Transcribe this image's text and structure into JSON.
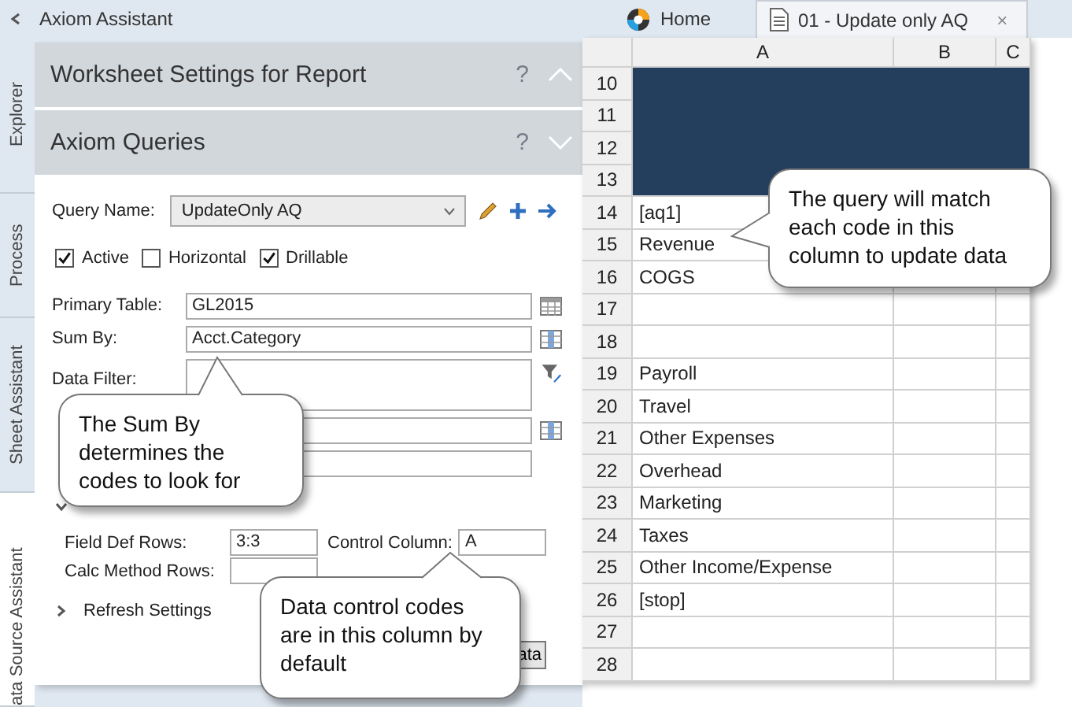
{
  "sidebar_title": "Axiom Assistant",
  "side_tabs": [
    {
      "label": "Explorer",
      "selected": false
    },
    {
      "label": "Process",
      "selected": false
    },
    {
      "label": "Sheet Assistant",
      "selected": false
    },
    {
      "label": "ata Source Assistant",
      "selected": true
    }
  ],
  "sections": [
    {
      "title": "Worksheet Settings for Report",
      "help": "?",
      "expanded": false
    },
    {
      "title": "Axiom Queries",
      "help": "?",
      "expanded": true
    }
  ],
  "query": {
    "label": "Query Name:",
    "value": "UpdateOnly AQ"
  },
  "checkboxes": [
    {
      "label": "Active",
      "checked": true
    },
    {
      "label": "Horizontal",
      "checked": false
    },
    {
      "label": "Drillable",
      "checked": true
    }
  ],
  "fields": [
    {
      "label": "Primary Table:",
      "value": "GL2015",
      "kind": "line"
    },
    {
      "label": "Sum By:",
      "value": "Acct.Category",
      "kind": "line"
    },
    {
      "label": "Data Filter:",
      "kind": "multiline"
    },
    {
      "kind": "line"
    },
    {
      "kind": "line"
    }
  ],
  "control_group": {
    "expanded": true
  },
  "field_def_rows": {
    "label": "Field Def Rows:",
    "value": "3:3"
  },
  "control_column": {
    "label": "Control Column:",
    "value": "A"
  },
  "calc_method_rows": {
    "label": "Calc Method Rows:"
  },
  "refresh_settings": {
    "label": "Refresh Settings",
    "expanded": false
  },
  "button": "ata",
  "tabs": [
    {
      "label": "Home",
      "kind": "home",
      "selected": false
    },
    {
      "label": "01 - Update only AQ",
      "kind": "document",
      "selected": true,
      "close": "×"
    }
  ],
  "sheet": {
    "columns": [
      "A",
      "B",
      "C"
    ],
    "rows": [
      {
        "number": "10",
        "kind": "band"
      },
      {
        "number": "11",
        "kind": "band"
      },
      {
        "number": "12",
        "kind": "band"
      },
      {
        "number": "13",
        "kind": "band"
      },
      {
        "number": "14",
        "kind": "plain",
        "a": "[aq1]"
      },
      {
        "number": "15",
        "kind": "plain",
        "a": "Revenue"
      },
      {
        "number": "16",
        "kind": "plain",
        "a": "COGS"
      },
      {
        "number": "17",
        "kind": "plain"
      },
      {
        "number": "18",
        "kind": "plain"
      },
      {
        "number": "19",
        "kind": "plain",
        "a": "Payroll"
      },
      {
        "number": "20",
        "kind": "plain",
        "a": "Travel"
      },
      {
        "number": "21",
        "kind": "plain",
        "a": "Other Expenses"
      },
      {
        "number": "22",
        "kind": "plain",
        "a": "Overhead"
      },
      {
        "number": "23",
        "kind": "plain",
        "a": "Marketing"
      },
      {
        "number": "24",
        "kind": "plain",
        "a": "Taxes"
      },
      {
        "number": "25",
        "kind": "plain",
        "a": "Other Income/Expense"
      },
      {
        "number": "26",
        "kind": "plain",
        "a": "[stop]"
      },
      {
        "number": "27",
        "kind": "plain"
      },
      {
        "number": "28",
        "kind": "plain"
      }
    ]
  },
  "callouts": [
    {
      "text": "The query will match each code in this column to update data"
    },
    {
      "text": "The Sum By determines the codes to look for"
    },
    {
      "text": "Data control codes are in this column by default"
    }
  ]
}
